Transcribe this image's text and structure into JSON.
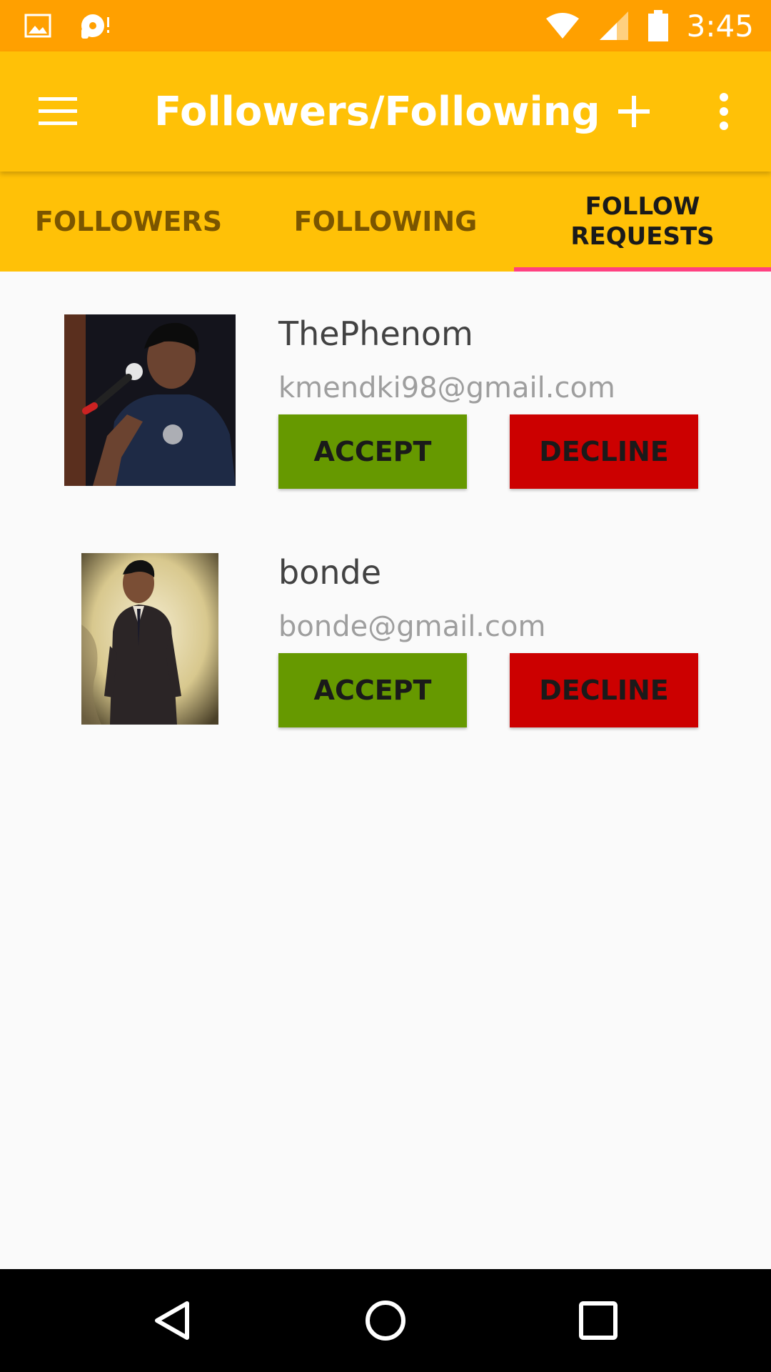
{
  "status_bar": {
    "time": "3:45"
  },
  "app_bar": {
    "title": "Followers/Following"
  },
  "tabs": [
    {
      "label": "FOLLOWERS",
      "active": false
    },
    {
      "label": "FOLLOWING",
      "active": false
    },
    {
      "label": "FOLLOW\nREQUESTS",
      "active": true
    }
  ],
  "requests": [
    {
      "name": "ThePhenom",
      "email": "kmendki98@gmail.com",
      "accept_label": "ACCEPT",
      "decline_label": "DECLINE"
    },
    {
      "name": "bonde",
      "email": "bonde@gmail.com",
      "accept_label": "ACCEPT",
      "decline_label": "DECLINE"
    }
  ],
  "colors": {
    "status_bar": "#ffa000",
    "app_bar": "#ffc107",
    "tab_indicator": "#ff4081",
    "accept": "#669900",
    "decline": "#cc0000"
  }
}
